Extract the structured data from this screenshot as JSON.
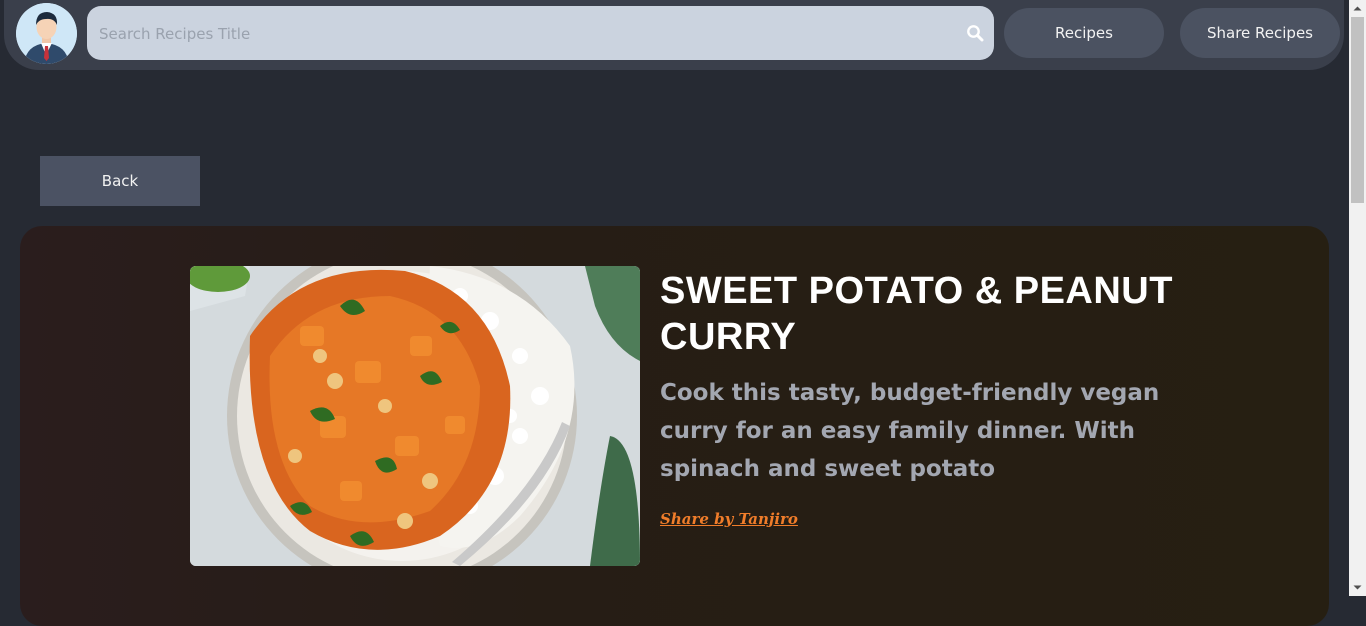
{
  "header": {
    "search": {
      "placeholder": "Search Recipes Title",
      "value": ""
    },
    "recipes_label": "Recipes",
    "share_label": "Share Recipes"
  },
  "back_label": "Back",
  "recipe": {
    "title": "SWEET POTATO & PEANUT CURRY",
    "description": "Cook this tasty, budget-friendly vegan curry for an easy family dinner. With spinach and sweet potato",
    "share_by": "Share by Tanjiro"
  },
  "icons": {
    "avatar": "user-avatar-icon",
    "search": "search-icon",
    "scroll_up": "arrow-up-icon",
    "scroll_down": "arrow-down-icon"
  },
  "colors": {
    "background": "#262a33",
    "navbar": "#3a3f4b",
    "button": "#4b5261",
    "accent": "#f07d2a"
  }
}
